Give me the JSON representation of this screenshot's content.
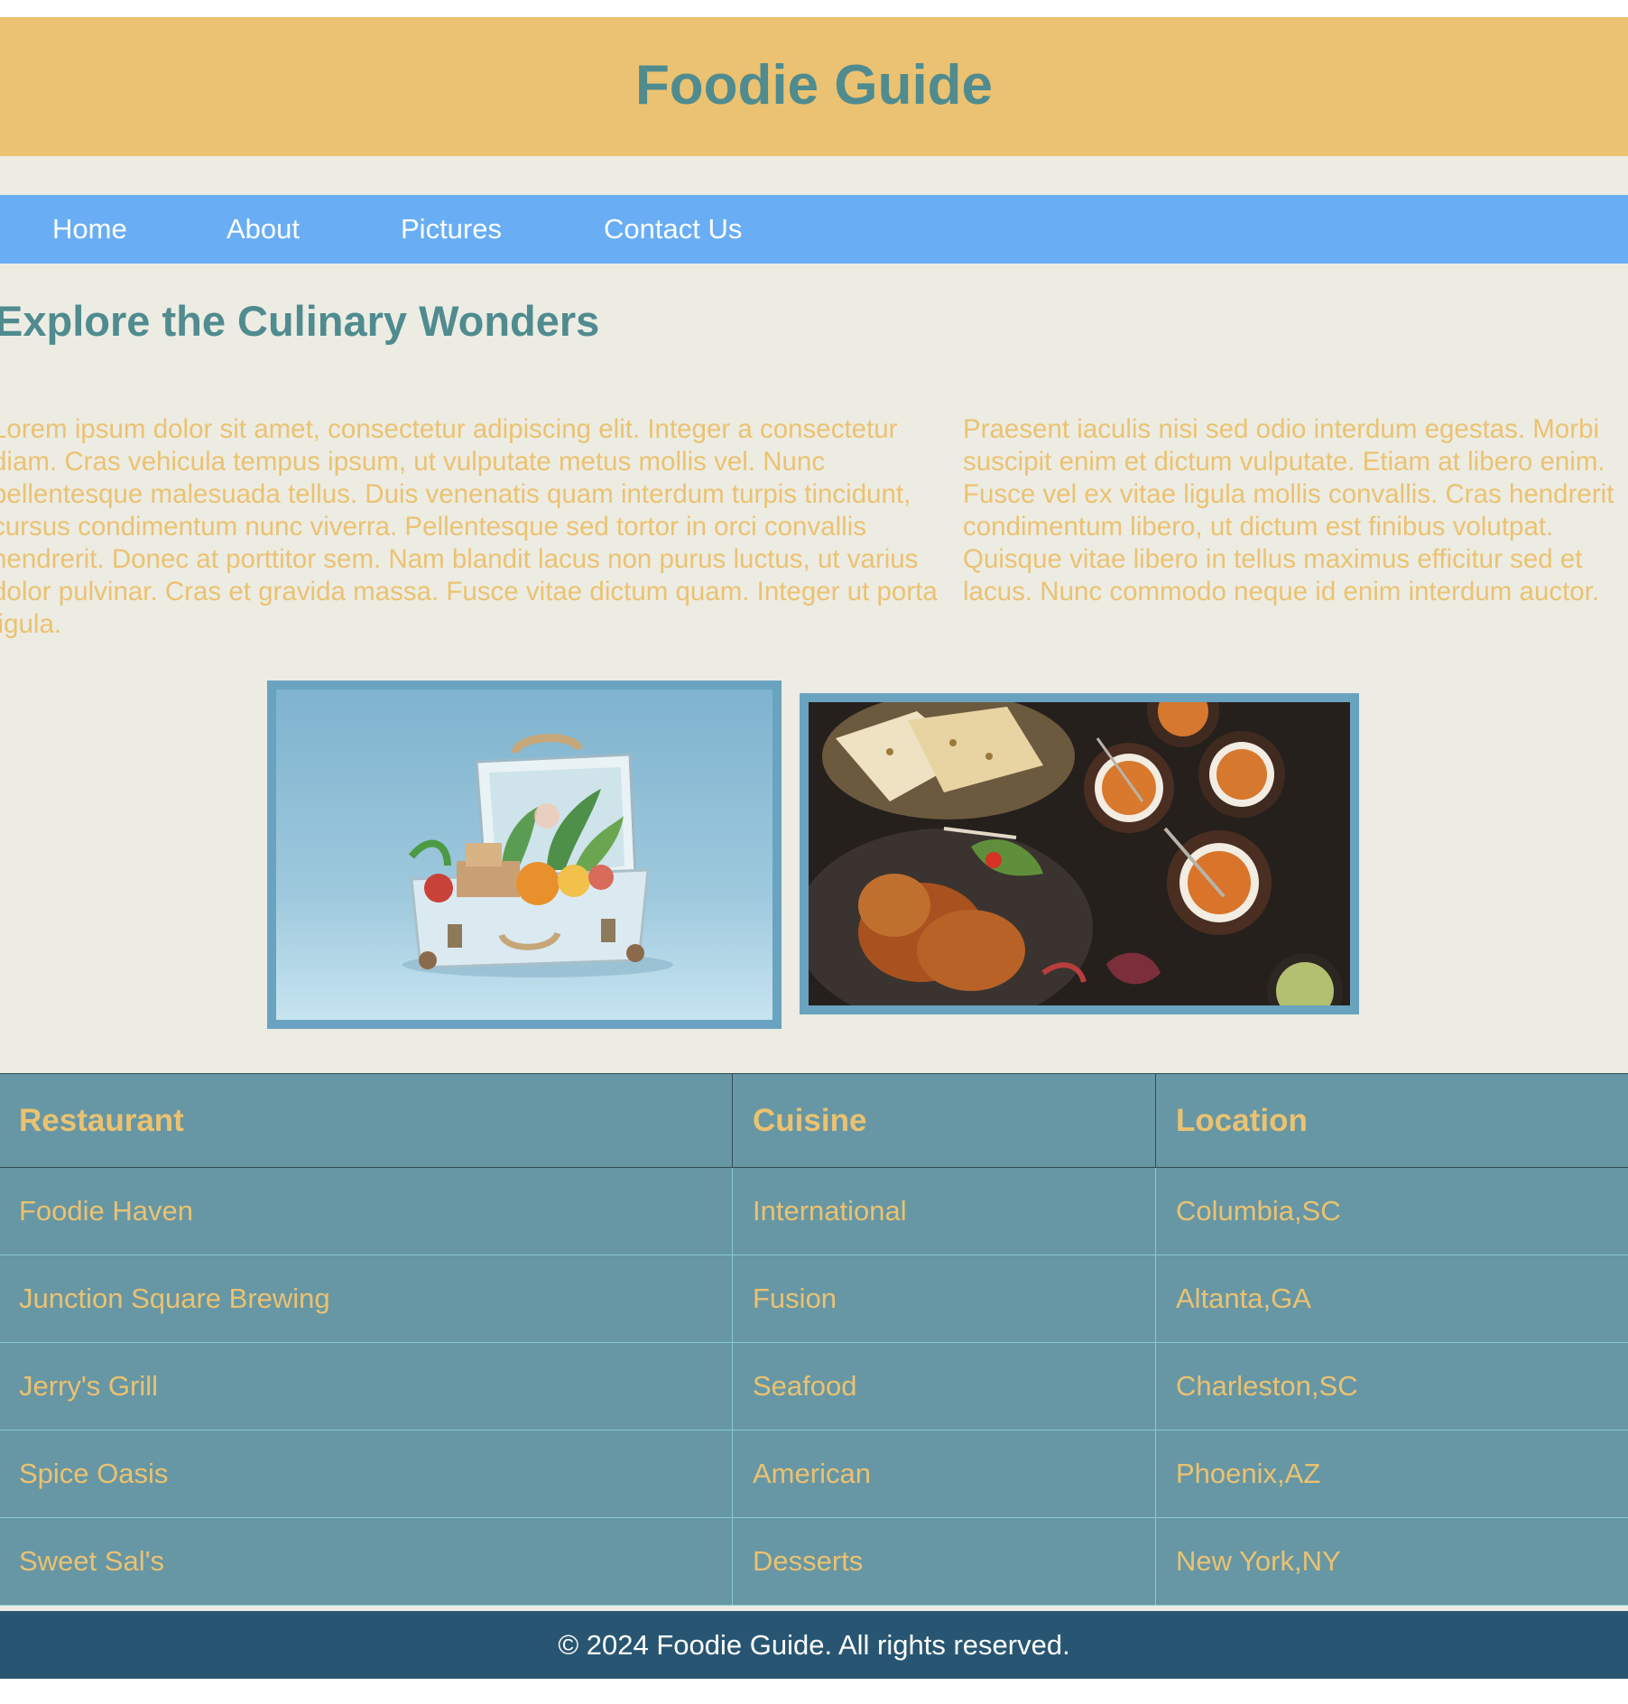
{
  "header": {
    "title": "Foodie Guide"
  },
  "nav": {
    "items": [
      {
        "label": "Home"
      },
      {
        "label": "About"
      },
      {
        "label": "Pictures"
      },
      {
        "label": "Contact Us"
      }
    ]
  },
  "main": {
    "heading": "Explore the Culinary Wonders",
    "paragraph_left": "Lorem ipsum dolor sit amet, consectetur adipiscing elit. Integer a consectetur diam. Cras vehicula tempus ipsum, ut vulputate metus mollis vel. Nunc pellentesque malesuada tellus. Duis venenatis quam interdum turpis tincidunt, cursus condimentum nunc viverra. Pellentesque sed tortor in orci convallis hendrerit. Donec at porttitor sem. Nam blandit lacus non purus luctus, ut varius dolor pulvinar. Cras et gravida massa. Fusce vitae dictum quam. Integer ut porta ligula.",
    "paragraph_right": "Praesent iaculis nisi sed odio interdum egestas. Morbi suscipit enim et dictum vulputate. Etiam at libero enim. Fusce vel ex vitae ligula mollis convallis. Cras hendrerit condimentum libero, ut dictum est finibus volutpat. Quisque vitae libero in tellus maximus efficitur sed et lacus. Nunc commodo neque id enim interdum auctor."
  },
  "images": [
    {
      "subject": "suitcase-with-food"
    },
    {
      "subject": "indian-food-spread"
    }
  ],
  "table": {
    "headers": [
      "Restaurant",
      "Cuisine",
      "Location"
    ],
    "rows": [
      [
        "Foodie Haven",
        "International",
        "Columbia,SC"
      ],
      [
        "Junction Square Brewing",
        "Fusion",
        "Altanta,GA"
      ],
      [
        "Jerry's Grill",
        "Seafood",
        "Charleston,SC"
      ],
      [
        "Spice Oasis",
        "American",
        "Phoenix,AZ"
      ],
      [
        "Sweet Sal's",
        "Desserts",
        "New York,NY"
      ]
    ]
  },
  "footer": {
    "text": "© 2024 Foodie Guide. All rights reserved."
  },
  "colors": {
    "header_bg": "#ebc271",
    "title_color": "#4f8b8f",
    "nav_bg": "#69aef4",
    "page_bg": "#ecece3",
    "table_bg": "#6797a4",
    "accent_text": "#ebc271",
    "footer_bg": "#285672",
    "image_border": "#6aa3bf"
  }
}
